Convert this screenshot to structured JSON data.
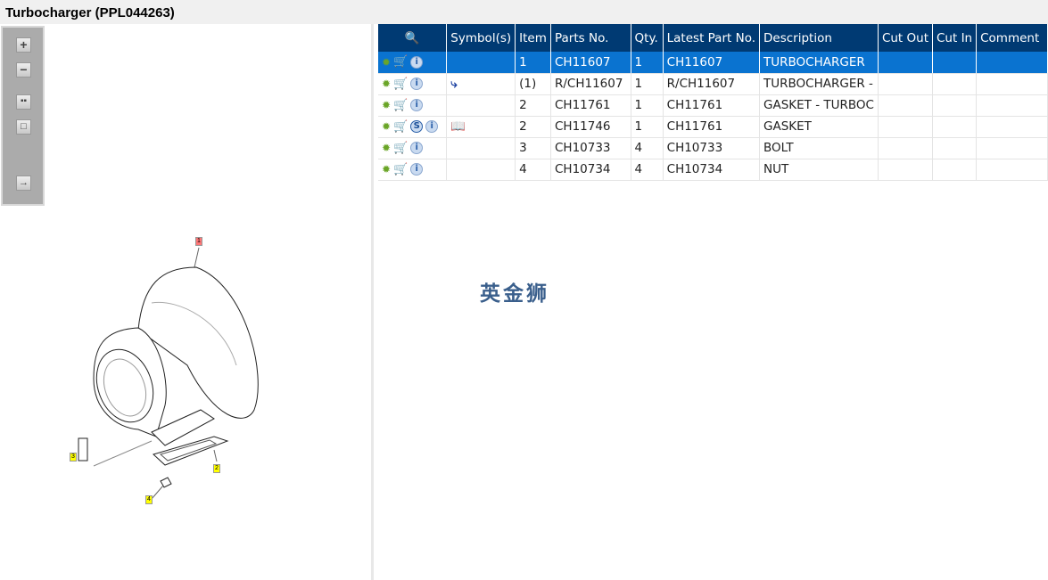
{
  "title": "Turbocharger (PPL044263)",
  "toolbar": [
    {
      "icon": "zoom-in-icon"
    },
    {
      "icon": "zoom-out-icon"
    },
    {
      "icon": "fit-all-icon"
    },
    {
      "icon": "fit-window-icon"
    },
    {
      "icon": "export-icon"
    }
  ],
  "diagram": {
    "callouts": [
      "1",
      "2",
      "3",
      "4"
    ],
    "highlight_color": "#ff7777",
    "callout_color": "#ffff00"
  },
  "table": {
    "headers": [
      "",
      "Symbol(s)",
      "Item",
      "Parts No.",
      "Qty.",
      "Latest Part No.",
      "Description",
      "Cut Out",
      "Cut In",
      "Comment"
    ],
    "rows": [
      {
        "item": "1",
        "part": "CH11607",
        "qty": "1",
        "latest": "CH11607",
        "desc": "TURBOCHARGER",
        "s": false,
        "symbol": "",
        "selected": true
      },
      {
        "item": "(1)",
        "part": "R/CH11607",
        "qty": "1",
        "latest": "R/CH11607",
        "desc": "TURBOCHARGER - ",
        "s": false,
        "symbol": "replacement-icon",
        "selected": false
      },
      {
        "item": "2",
        "part": "CH11761",
        "qty": "1",
        "latest": "CH11761",
        "desc": "GASKET - TURBOC",
        "s": false,
        "symbol": "",
        "selected": false
      },
      {
        "item": "2",
        "part": "CH11746",
        "qty": "1",
        "latest": "CH11761",
        "desc": "GASKET",
        "s": true,
        "symbol": "book-icon",
        "selected": false
      },
      {
        "item": "3",
        "part": "CH10733",
        "qty": "4",
        "latest": "CH10733",
        "desc": "BOLT",
        "s": false,
        "symbol": "",
        "selected": false
      },
      {
        "item": "4",
        "part": "CH10734",
        "qty": "4",
        "latest": "CH10734",
        "desc": "NUT",
        "s": false,
        "symbol": "",
        "selected": false
      }
    ]
  },
  "watermark": "英金狮",
  "colors": {
    "header": "#003a73",
    "selected": "#0a73d0"
  }
}
